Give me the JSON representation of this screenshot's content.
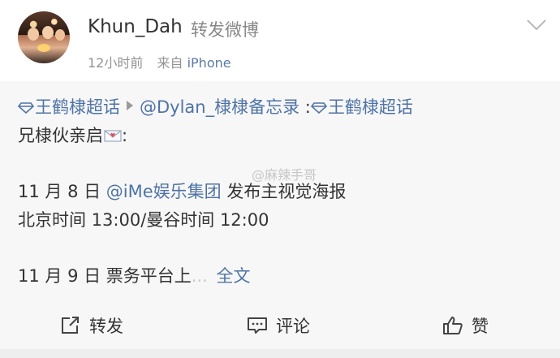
{
  "header": {
    "username": "Khun_Dah",
    "action": "转发微博",
    "time": "12小时前",
    "source_prefix": "来自",
    "source": "iPhone"
  },
  "post": {
    "line1": {
      "topic1": "王鹤棣超话",
      "mention": "@Dylan_棣棣备忘录",
      "colon": " :",
      "topic2": "王鹤棣超话"
    },
    "line2": "兄棣伙亲启",
    "line2_suffix": ":",
    "line3_prefix": "11 月 8 日 ",
    "line3_mention": "@iMe娱乐集团",
    "line3_suffix": " 发布主视觉海报",
    "line4": "北京时间 13:00/曼谷时间 12:00",
    "line5": "11 月 9 日 票务平台上",
    "line5_fade": "...",
    "full_text": "全文",
    "watermark": "@麻辣手哥"
  },
  "actions": {
    "repost": "转发",
    "comment": "评论",
    "like": "赞"
  },
  "colors": {
    "link": "#4f73a6",
    "meta": "#939393",
    "content_bg": "#f7f7f7"
  },
  "icons": [
    "diamond-icon",
    "triangle-arrow-icon",
    "envelope-icon",
    "chevron-down-icon",
    "repost-icon",
    "comment-icon",
    "like-icon"
  ]
}
